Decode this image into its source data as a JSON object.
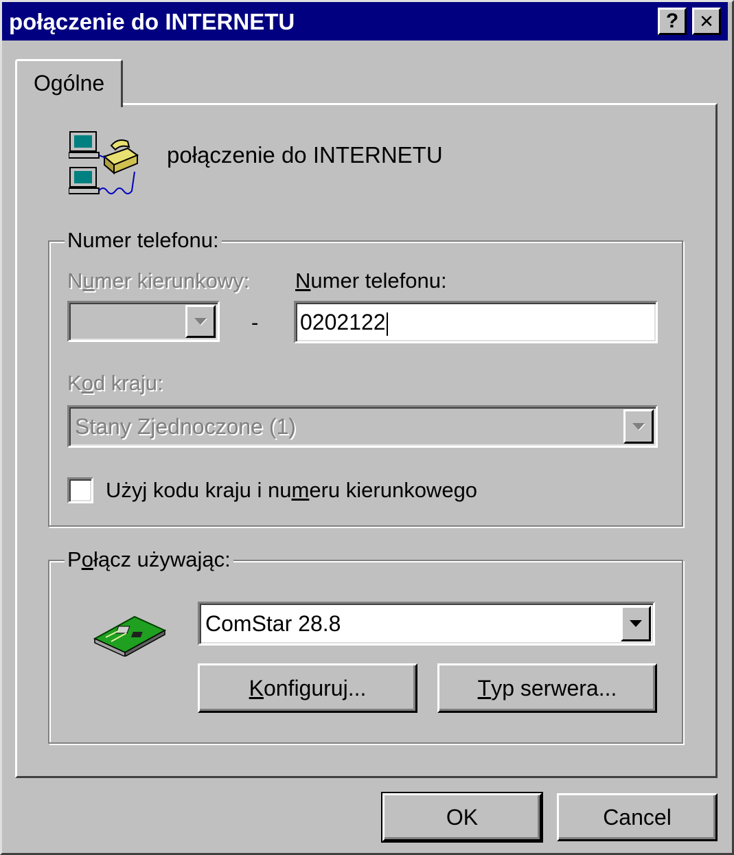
{
  "window": {
    "title": "połączenie do INTERNETU",
    "help_glyph": "?",
    "close_glyph": "✕"
  },
  "tabs": [
    {
      "label": "Ogólne",
      "selected": true
    }
  ],
  "connection": {
    "name": "połączenie do INTERNETU",
    "icon": "dial-up-networking-icon"
  },
  "phone_group": {
    "legend": "Numer telefonu:",
    "area_code": {
      "label_pre": "N",
      "label_u": "u",
      "label_post": "mer kierunkowy:",
      "value": "",
      "enabled": false
    },
    "separator": "-",
    "phone_number": {
      "label_u": "N",
      "label_post": "umer telefonu:",
      "value": "0202122"
    },
    "country_code": {
      "label_pre": "K",
      "label_u": "o",
      "label_post": "d kraju:",
      "value": "Stany Zjednoczone (1)",
      "enabled": false
    },
    "use_codes_checkbox": {
      "label_pre": "Użyj kodu kraju i nu",
      "label_u": "m",
      "label_post": "eru kierunkowego",
      "checked": false
    }
  },
  "connect_group": {
    "legend_pre": "P",
    "legend_u": "o",
    "legend_post": "łącz używając:",
    "device_icon": "modem-card-icon",
    "device": "ComStar 28.8",
    "configure_btn": {
      "u": "K",
      "rest": "onfiguruj..."
    },
    "server_type_btn": {
      "u": "T",
      "rest": "yp serwera..."
    }
  },
  "footer": {
    "ok": "OK",
    "cancel": "Cancel"
  },
  "colors": {
    "titlebar": "#000080",
    "face": "#c0c0c0",
    "disabled_text": "#808080"
  }
}
